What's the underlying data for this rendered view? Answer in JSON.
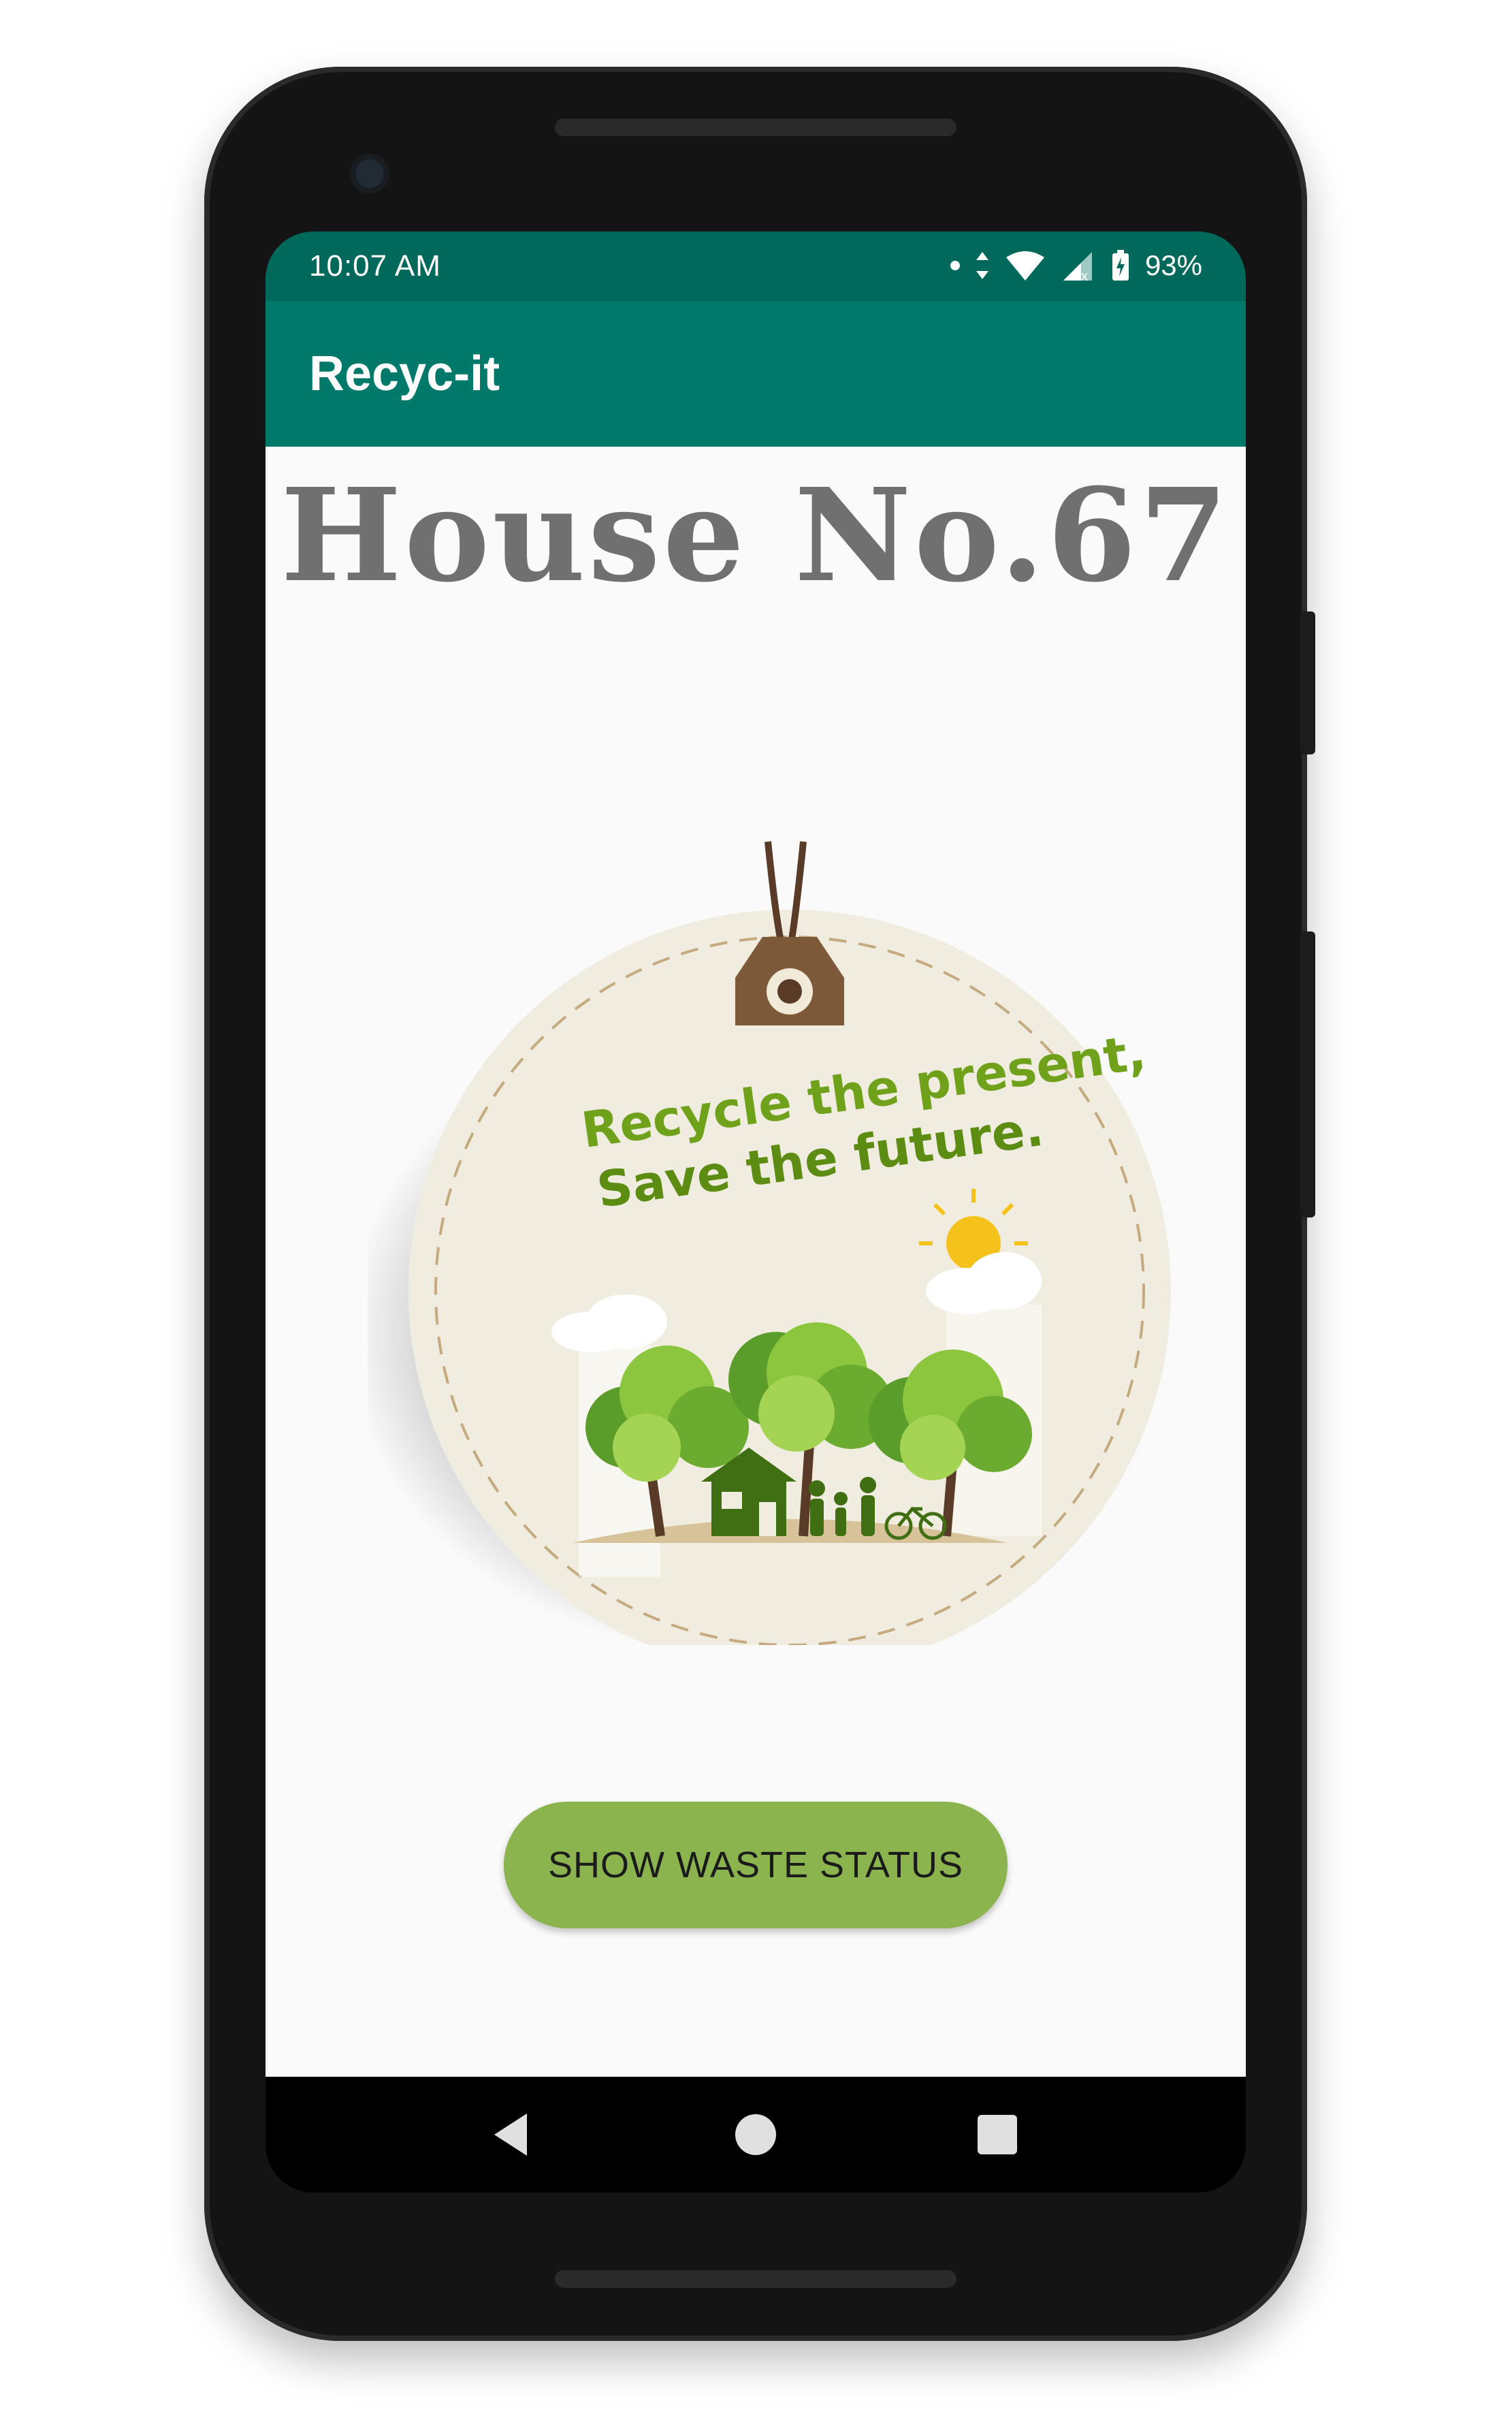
{
  "status_bar": {
    "time": "10:07 AM",
    "battery": "93%"
  },
  "app_bar": {
    "title": "Recyc-it"
  },
  "main": {
    "house_label": "House No.67",
    "badge_slogan_line1": "Recycle the present,",
    "badge_slogan_line2": "Save the future.",
    "button_label": "SHOW WASTE STATUS"
  },
  "nav": {
    "back": "back-icon",
    "home": "home-icon",
    "recents": "recents-icon"
  },
  "colors": {
    "status_bar": "#00695c",
    "app_bar": "#00796b",
    "button": "#8bb34e",
    "slogan": "#6fa21a"
  }
}
